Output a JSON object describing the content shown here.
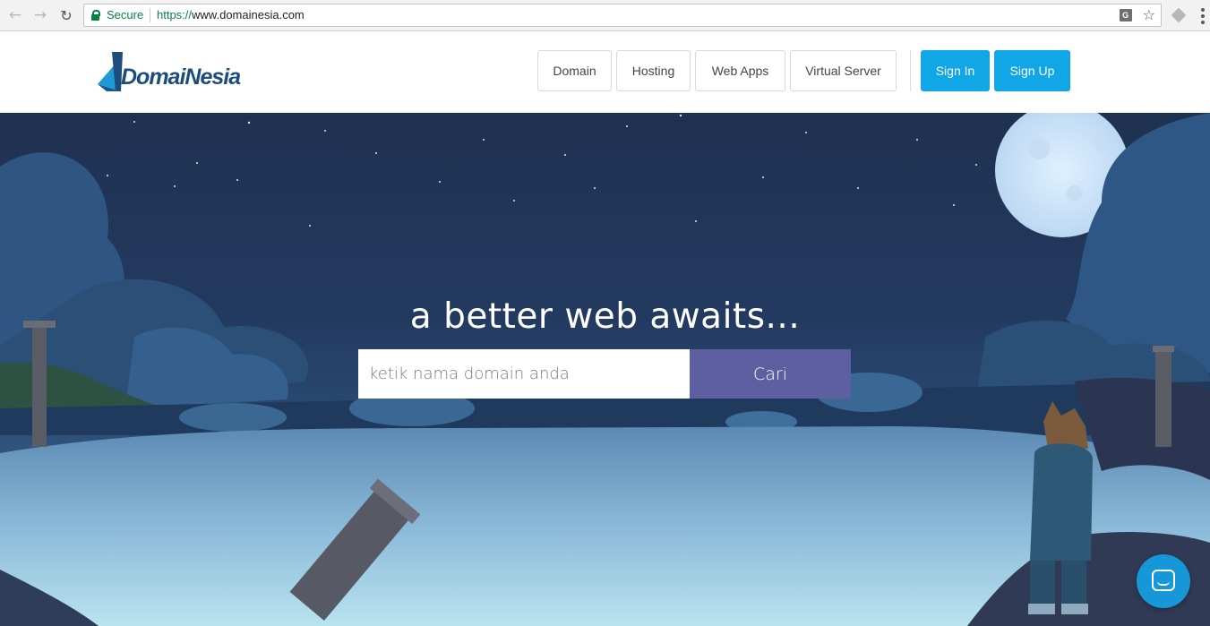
{
  "browser": {
    "secure_label": "Secure",
    "url_scheme": "https://",
    "url_host": "www.domainesia.com",
    "translate_icon": "translate-icon",
    "star_icon": "star-icon"
  },
  "header": {
    "logo_text": "DomaiNesia",
    "nav": [
      {
        "label": "Domain"
      },
      {
        "label": "Hosting"
      },
      {
        "label": "Web Apps"
      },
      {
        "label": "Virtual Server"
      }
    ],
    "sign_in": "Sign In",
    "sign_up": "Sign Up",
    "accent_color": "#11a6e5"
  },
  "hero": {
    "title": "a better web awaits...",
    "search_placeholder": "ketik nama domain anda",
    "search_button": "Cari",
    "button_color": "#5e5fa1"
  },
  "chat": {
    "icon": "chat-icon"
  }
}
